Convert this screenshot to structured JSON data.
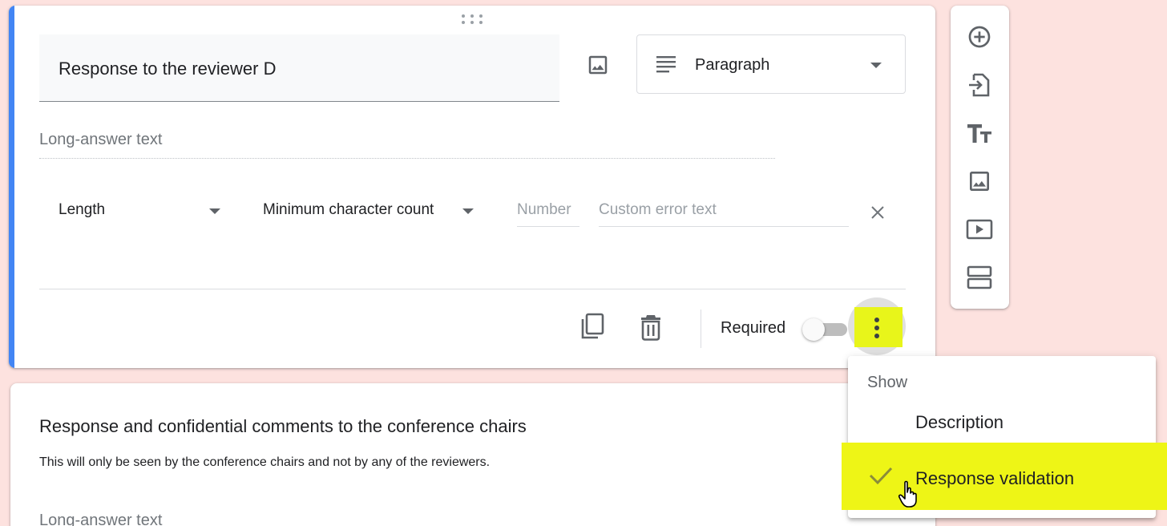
{
  "colors": {
    "page_background": "#fde2df",
    "accent": "#4285f4",
    "highlight": "#eef516",
    "text_primary": "#202124",
    "text_secondary": "#70757a"
  },
  "question_card": {
    "title": "Response to the reviewer D",
    "add_image_icon": "image-icon",
    "question_type": {
      "selected": "Paragraph",
      "icon": "paragraph-lines-icon"
    },
    "answer_placeholder": "Long-answer text",
    "validation": {
      "rule_type": "Length",
      "condition": "Minimum character count",
      "number_placeholder": "Number",
      "error_placeholder": "Custom error text",
      "remove_icon": "close-icon"
    },
    "footer": {
      "duplicate_icon": "copy-icon",
      "delete_icon": "trash-icon",
      "required_label": "Required",
      "required_on": false,
      "more_icon": "more-vert-icon"
    }
  },
  "next_card": {
    "title": "Response and confidential comments to the conference chairs",
    "description": "This will only be seen by the conference chairs and not by any of the reviewers.",
    "answer_placeholder": "Long-answer text"
  },
  "side_toolbar": {
    "buttons": [
      {
        "name": "add-question",
        "icon": "add-circle-icon"
      },
      {
        "name": "import-questions",
        "icon": "import-icon"
      },
      {
        "name": "add-title-description",
        "icon": "text-size-icon"
      },
      {
        "name": "add-image",
        "icon": "image-icon"
      },
      {
        "name": "add-video",
        "icon": "video-icon"
      },
      {
        "name": "add-section",
        "icon": "section-icon"
      }
    ]
  },
  "more_menu": {
    "header": "Show",
    "items": [
      {
        "label": "Description",
        "checked": false
      },
      {
        "label": "Response validation",
        "checked": true
      }
    ]
  }
}
